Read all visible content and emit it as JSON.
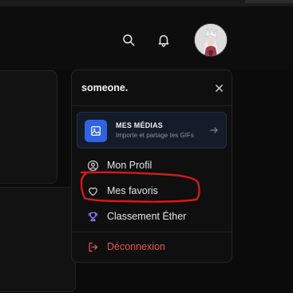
{
  "header": {
    "search_icon": "search-icon",
    "bell_icon": "bell-icon",
    "avatar": "avatar"
  },
  "menu": {
    "username": "someone.",
    "close_icon": "close-icon",
    "media_card": {
      "title": "MES MÉDIAS",
      "subtitle": "Importe et partage tes GIFs",
      "icon": "image-icon",
      "arrow_icon": "arrow-right-icon"
    },
    "items": [
      {
        "label": "Mon Profil",
        "icon": "user-circle-icon",
        "color": "#cfcfcf"
      },
      {
        "label": "Mes favoris",
        "icon": "heart-icon",
        "color": "#cfcfcf"
      },
      {
        "label": "Classement Éther",
        "icon": "trophy-icon",
        "color": "#8b7cf6"
      },
      {
        "label": "Déconnexion",
        "icon": "logout-icon",
        "color": "#e35454"
      }
    ]
  },
  "colors": {
    "accent": "#2f63e2",
    "highlight_stroke": "#d61a1a",
    "danger": "#e35454"
  }
}
